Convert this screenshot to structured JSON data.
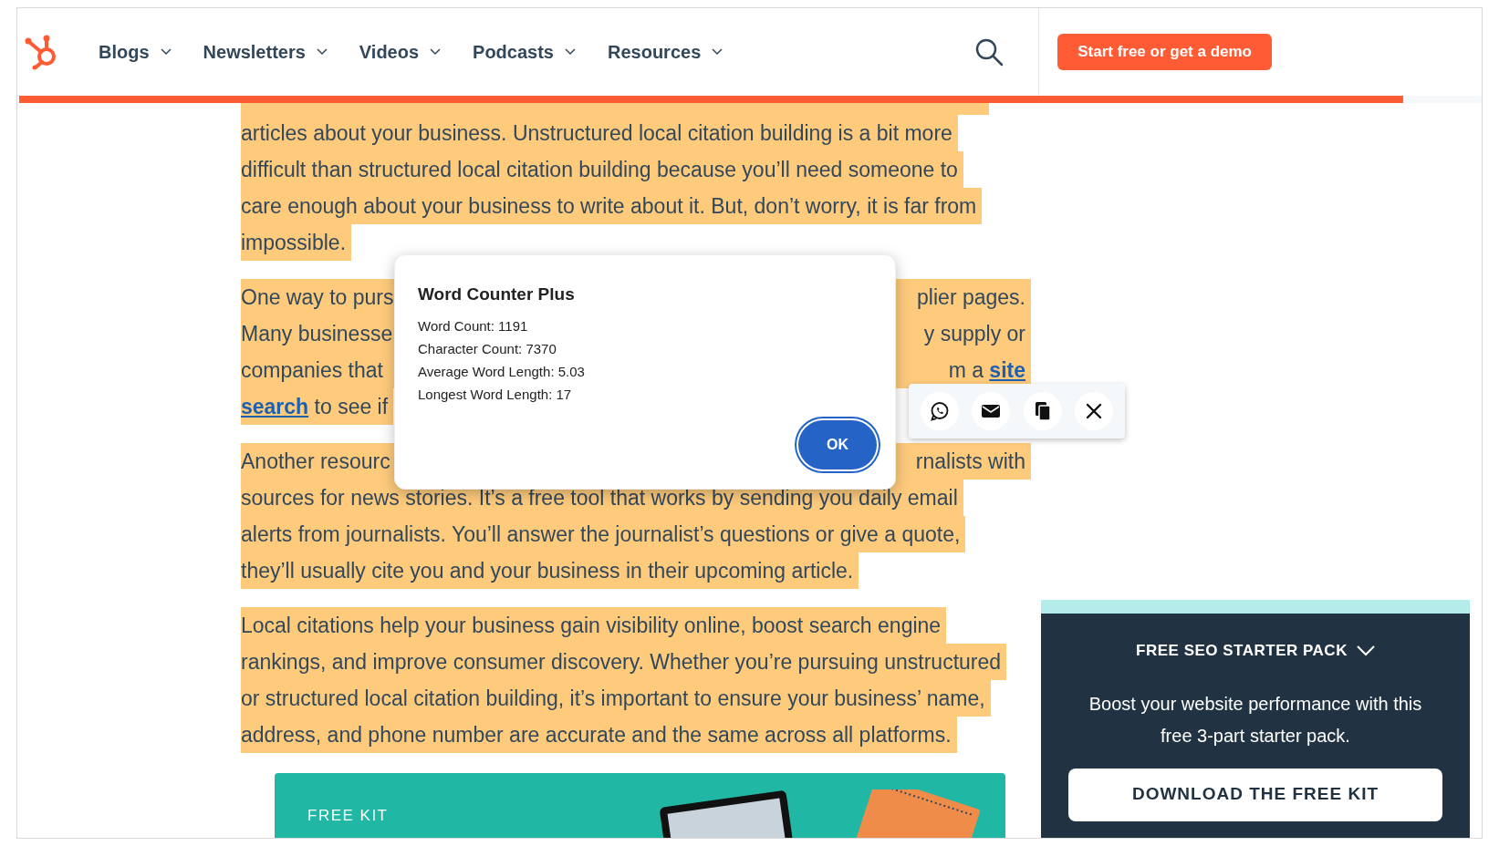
{
  "header": {
    "nav": [
      {
        "label": "Blogs"
      },
      {
        "label": "Newsletters"
      },
      {
        "label": "Videos"
      },
      {
        "label": "Podcasts"
      },
      {
        "label": "Resources"
      }
    ],
    "cta": "Start free or get a demo"
  },
  "article": {
    "paragraphs": [
      {
        "lines": [
          {
            "left": [
              {
                "kind": "text",
                "text": "articles about your business. Unstructured local citation building is a bit more"
              }
            ]
          },
          {
            "left": [
              {
                "kind": "text",
                "text": "difficult than structured local citation building because you’ll need someone to"
              }
            ]
          },
          {
            "left": [
              {
                "kind": "text",
                "text": "care enough about your business to write about it. But, don’t worry, it is far from"
              }
            ]
          },
          {
            "left": [
              {
                "kind": "text",
                "text": "impossible."
              }
            ]
          }
        ]
      },
      {
        "lines": [
          {
            "left": [
              {
                "kind": "text",
                "text": "One way to purs"
              }
            ],
            "right": [
              {
                "kind": "text",
                "text": "plier pages."
              }
            ]
          },
          {
            "left": [
              {
                "kind": "text",
                "text": "Many businesse"
              }
            ],
            "right": [
              {
                "kind": "text",
                "text": "y supply or"
              }
            ]
          },
          {
            "left": [
              {
                "kind": "text",
                "text": "companies that"
              }
            ],
            "right": [
              {
                "kind": "text",
                "text": "m a "
              },
              {
                "kind": "link",
                "text": "site"
              }
            ]
          },
          {
            "left": [
              {
                "kind": "link",
                "text": "search"
              },
              {
                "kind": "text",
                "text": " to see if"
              }
            ]
          }
        ]
      },
      {
        "lines": [
          {
            "left": [
              {
                "kind": "text",
                "text": "Another resourc"
              }
            ],
            "right": [
              {
                "kind": "text",
                "text": "rnalists with"
              }
            ]
          },
          {
            "left": [
              {
                "kind": "text",
                "text": "sources for news stories. It’s a free tool that works by sending you daily email"
              }
            ]
          },
          {
            "left": [
              {
                "kind": "text",
                "text": "alerts from journalists. You’ll answer the journalist’s questions or give a quote,"
              }
            ]
          },
          {
            "left": [
              {
                "kind": "text",
                "text": "they’ll usually cite you and your business in their upcoming article."
              }
            ]
          }
        ]
      },
      {
        "lines": [
          {
            "left": [
              {
                "kind": "text",
                "text": "Local citations help your business gain visibility online, boost search engine"
              }
            ]
          },
          {
            "left": [
              {
                "kind": "text",
                "text": "rankings, and improve consumer discovery. Whether you’re pursuing unstructured"
              }
            ]
          },
          {
            "left": [
              {
                "kind": "text",
                "text": "or structured local citation building, it’s important to ensure your business’ name,"
              }
            ]
          },
          {
            "left": [
              {
                "kind": "text",
                "text": "address, and phone number are accurate and the same across all platforms."
              }
            ]
          }
        ]
      }
    ]
  },
  "reading_progress": {
    "level": 0.945
  },
  "banner": {
    "label": "FREE KIT"
  },
  "dialog": {
    "title": "Word Counter Plus",
    "lines": [
      "Word Count: 1191",
      "Character Count: 7370",
      "Average Word Length: 5.03",
      "Longest Word Length: 17"
    ],
    "button": "OK"
  },
  "share_toolbar": {
    "items": [
      {
        "kind": "whatsapp"
      },
      {
        "kind": "email"
      },
      {
        "kind": "copy"
      },
      {
        "kind": "close"
      }
    ]
  },
  "sidebar": {
    "title": "FREE SEO STARTER PACK",
    "text": "Boost your website performance with this free 3-part starter pack.",
    "button": "DOWNLOAD THE FREE KIT"
  }
}
